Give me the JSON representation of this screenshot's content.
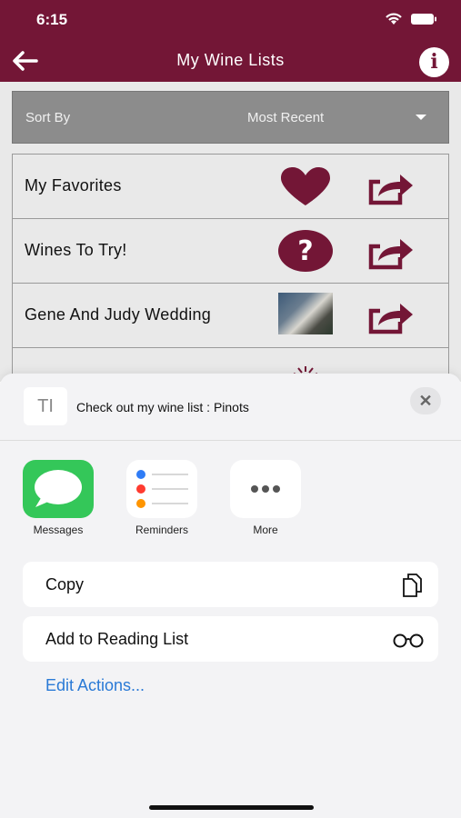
{
  "status": {
    "time": "6:15"
  },
  "nav": {
    "title": "My Wine Lists",
    "back_icon": "arrow-left-icon",
    "info_label": "i"
  },
  "sort": {
    "label": "Sort By",
    "value": "Most Recent"
  },
  "lists": [
    {
      "name": "My Favorites",
      "icon": "heart-icon"
    },
    {
      "name": "Wines To Try!",
      "icon": "question-icon"
    },
    {
      "name": "Gene And Judy Wedding",
      "icon": "photo-thumbnail"
    },
    {
      "name": "",
      "icon": "grape-icon"
    }
  ],
  "share": {
    "doc_glyph": "TI",
    "title": "Check out my wine list : Pinots",
    "close_label": "✕",
    "apps": [
      {
        "label": "Messages"
      },
      {
        "label": "Reminders"
      },
      {
        "label": "More"
      }
    ],
    "actions": [
      {
        "label": "Copy",
        "icon": "copy-icon"
      },
      {
        "label": "Add to Reading List",
        "icon": "glasses-icon"
      }
    ],
    "edit_actions": "Edit Actions..."
  },
  "colors": {
    "brand": "#731636",
    "link": "#2a7ad6",
    "messages": "#34c759"
  }
}
